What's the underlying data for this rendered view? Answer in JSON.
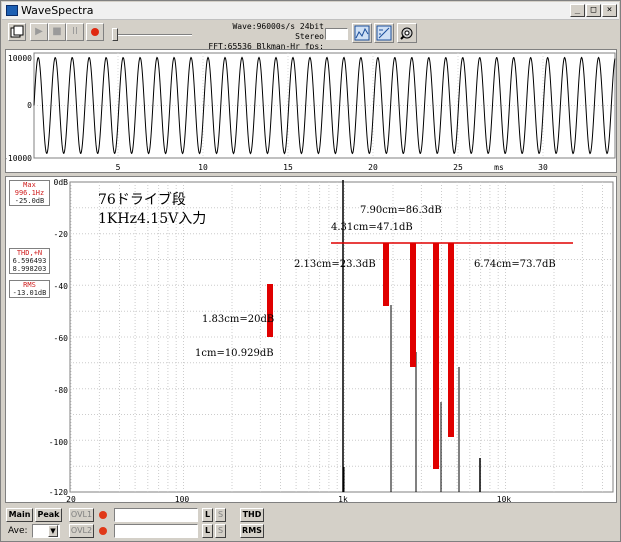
{
  "window": {
    "title": "WaveSpectra"
  },
  "title_buttons": {
    "minimize": "_",
    "maximize": "□",
    "close": "×"
  },
  "toolbar": {
    "tools": [
      "▶",
      "■",
      "II"
    ],
    "info_line1": "Wave:96000s/s 24bit Stereo",
    "info_line2": "FFT:65536 Blkman-Hr fps:"
  },
  "wave": {
    "y_labels": [
      "10000",
      "0",
      "-10000"
    ],
    "x_labels": [
      "5",
      "10",
      "15",
      "20",
      "25",
      "30"
    ],
    "x_unit": "ms"
  },
  "readouts": {
    "max_label": "Max",
    "max_freq": "996.1Hz",
    "max_level": "-25.0dB",
    "thd_label": "THD,+N",
    "thd_1": "6.596493",
    "thd_2": "8.998203",
    "rms_label": "RMS",
    "rms_val": "-13.01dB"
  },
  "spectrum": {
    "y_labels": [
      "0dB",
      "-20",
      "-40",
      "-60",
      "-80",
      "-100",
      "-120"
    ],
    "x_labels": [
      "20",
      "100",
      "1k",
      "10k"
    ]
  },
  "annotations": {
    "title1": "76ドライブ段",
    "title2": "1KHz4.15V入力",
    "a1": "7.90cm=86.3dB",
    "a2": "4.31cm=47.1dB",
    "a3": "2.13cm=23.3dB",
    "a4": "6.74cm=73.7dB",
    "a5": "1.83cm=20dB",
    "a6": "1cm=10.929dB"
  },
  "bottom": {
    "main": "Main",
    "peak": "Peak",
    "ovl1": "OVL1",
    "ovl2": "OVL2",
    "ave": "Ave:",
    "l": "L",
    "s": "S",
    "thd": "THD",
    "rms": "RMS"
  },
  "colors": {
    "accent_red": "#e00000",
    "trace": "#000000",
    "grid": "#c8c8c8"
  }
}
